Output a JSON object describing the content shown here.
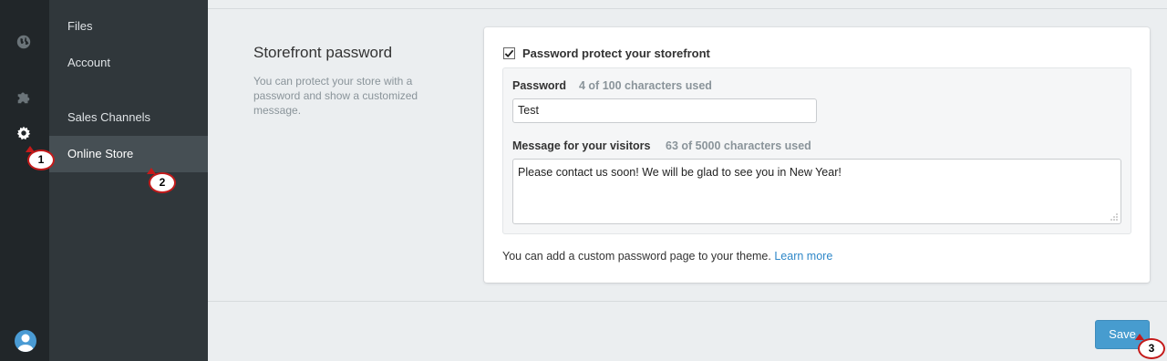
{
  "nav": {
    "items": [
      {
        "label": "Files"
      },
      {
        "label": "Account"
      },
      {
        "label": "Sales Channels"
      },
      {
        "label": "Online Store"
      }
    ]
  },
  "rail": {
    "icons": [
      "globe-icon",
      "puzzle-icon",
      "gear-icon",
      "user-avatar-icon"
    ]
  },
  "section": {
    "title": "Storefront password",
    "description": "You can protect your store with a password and show a customized message."
  },
  "form": {
    "protect_label": "Password protect your storefront",
    "protect_checked": true,
    "password_label": "Password",
    "password_hint": "4 of 100 characters used",
    "password_value": "Test",
    "message_label": "Message for your visitors",
    "message_hint": "63 of 5000 characters used",
    "message_value": "Please contact us soon! We will be glad to see you in New Year!",
    "help_text": "You can add a custom password page to your theme.",
    "help_link": "Learn more"
  },
  "actions": {
    "save_label": "Save"
  },
  "callouts": [
    "1",
    "2",
    "3"
  ],
  "colors": {
    "accent": "#479ccf",
    "link": "#2e87c8",
    "callout": "#c41a1a",
    "rail_bg": "#212629",
    "nav_bg": "#30373b"
  }
}
